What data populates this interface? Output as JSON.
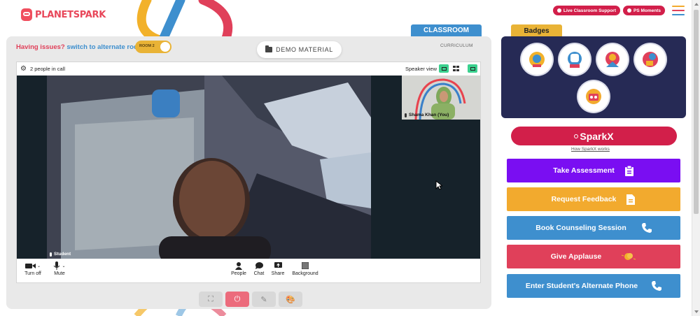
{
  "header": {
    "logo_text_a": "PLANET",
    "logo_text_b": "SPARK",
    "live_support_label": "Live Classroom Support",
    "ps_moments_label": "PS Moments"
  },
  "classroom": {
    "tab_label": "CLASSROOM",
    "curriculum_label": "CURRICULUM",
    "issues_label": "Having issues?",
    "alternate_link": "switch to alternate room",
    "room_toggle_label": "ROOM 2",
    "demo_material_label": "DEMO MATERIAL"
  },
  "call": {
    "people_count": "2 people in call",
    "speaker_view_label": "Speaker view",
    "main_participant": "Student",
    "self_participant": "Shama Khan (You)",
    "controls_left": [
      {
        "label": "Turn off",
        "icon": "video-camera-icon"
      },
      {
        "label": "Mute",
        "icon": "microphone-icon"
      }
    ],
    "controls_center": [
      {
        "label": "People",
        "icon": "person-icon"
      },
      {
        "label": "Chat",
        "icon": "chat-bubble-icon"
      },
      {
        "label": "Share",
        "icon": "share-screen-icon"
      },
      {
        "label": "Background",
        "icon": "background-icon"
      }
    ]
  },
  "bottom_tools": [
    {
      "icon": "fullscreen-icon"
    },
    {
      "icon": "power-icon"
    },
    {
      "icon": "pen-icon"
    },
    {
      "icon": "palette-icon"
    }
  ],
  "badges": {
    "tab_label": "Badges",
    "items": [
      "badge-1",
      "badge-2",
      "badge-3",
      "badge-4",
      "badge-5"
    ]
  },
  "sparkx": {
    "label": "SparkX",
    "how_link": "How SparkX works"
  },
  "actions": [
    {
      "label": "Take Assessment",
      "color": "#7a0ef2",
      "icon": "clipboard-icon"
    },
    {
      "label": "Request Feedback",
      "color": "#f2aa2e",
      "icon": "document-icon"
    },
    {
      "label": "Book Counseling Session",
      "color": "#3e8fce",
      "icon": "phone-icon"
    },
    {
      "label": "Give Applause",
      "color": "#e0405a",
      "icon": "clapping-hands-icon"
    },
    {
      "label": "Enter Student's Alternate Phone",
      "color": "#3e8fce",
      "icon": "phone-icon"
    }
  ],
  "colors": {
    "brand_red": "#d21f4a",
    "accent_blue": "#3e8fce",
    "accent_yellow": "#e9b336",
    "badges_bg": "#262a55"
  }
}
